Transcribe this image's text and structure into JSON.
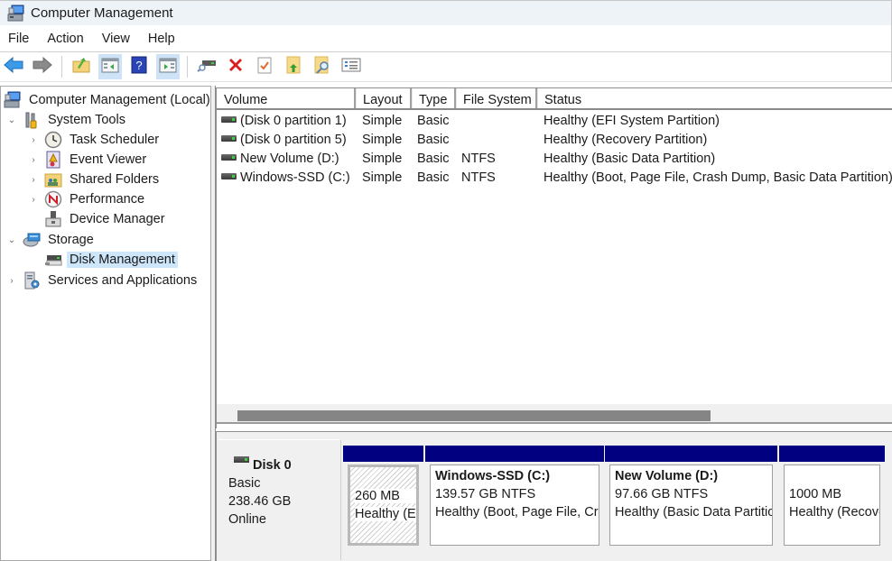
{
  "window": {
    "title": "Computer Management"
  },
  "menu": [
    "File",
    "Action",
    "View",
    "Help"
  ],
  "toolbar": {
    "buttons": [
      {
        "icon": "back-arrow-icon",
        "active": false
      },
      {
        "icon": "forward-arrow-icon",
        "active": false
      },
      {
        "icon": "up-folder-icon",
        "active": false
      },
      {
        "icon": "show-hide-console-tree-icon",
        "active": true
      },
      {
        "icon": "help-icon",
        "active": false
      },
      {
        "icon": "show-hide-action-pane-icon",
        "active": true
      },
      {
        "icon": "connect-virtual-disk-icon",
        "active": false
      },
      {
        "icon": "delete-icon",
        "active": false
      },
      {
        "icon": "properties-check-icon",
        "active": false
      },
      {
        "icon": "export-folder-icon",
        "active": false
      },
      {
        "icon": "search-folder-icon",
        "active": false
      },
      {
        "icon": "list-settings-icon",
        "active": false
      }
    ]
  },
  "tree": {
    "root": "Computer Management (Local)",
    "items": [
      {
        "label": "System Tools",
        "level": 1,
        "chevron": "expanded"
      },
      {
        "label": "Task Scheduler",
        "level": 2,
        "chevron": "collapsed"
      },
      {
        "label": "Event Viewer",
        "level": 2,
        "chevron": "collapsed"
      },
      {
        "label": "Shared Folders",
        "level": 2,
        "chevron": "collapsed"
      },
      {
        "label": "Performance",
        "level": 2,
        "chevron": "collapsed"
      },
      {
        "label": "Device Manager",
        "level": 2,
        "chevron": "none"
      },
      {
        "label": "Storage",
        "level": 1,
        "chevron": "expanded"
      },
      {
        "label": "Disk Management",
        "level": 2,
        "chevron": "none",
        "selected": true
      },
      {
        "label": "Services and Applications",
        "level": 1,
        "chevron": "collapsed"
      }
    ]
  },
  "volumes": {
    "columns": [
      "Volume",
      "Layout",
      "Type",
      "File System",
      "Status"
    ],
    "rows": [
      {
        "volume": "(Disk 0 partition 1)",
        "layout": "Simple",
        "type": "Basic",
        "fs": "",
        "status": "Healthy (EFI System Partition)"
      },
      {
        "volume": "(Disk 0 partition 5)",
        "layout": "Simple",
        "type": "Basic",
        "fs": "",
        "status": "Healthy (Recovery Partition)"
      },
      {
        "volume": "New Volume (D:)",
        "layout": "Simple",
        "type": "Basic",
        "fs": "NTFS",
        "status": "Healthy (Basic Data Partition)"
      },
      {
        "volume": "Windows-SSD (C:)",
        "layout": "Simple",
        "type": "Basic",
        "fs": "NTFS",
        "status": "Healthy (Boot, Page File, Crash Dump, Basic Data Partition)"
      }
    ]
  },
  "disk": {
    "name": "Disk 0",
    "type": "Basic",
    "size": "238.46 GB",
    "state": "Online",
    "partitions": [
      {
        "title": "",
        "size": "260 MB",
        "status": "Healthy (EFI System Partition)",
        "hatched": true
      },
      {
        "title": "Windows-SSD  (C:)",
        "size": "139.57 GB NTFS",
        "status": "Healthy (Boot, Page File, Crash Dump, Basic Data Partition)",
        "hatched": false
      },
      {
        "title": "New Volume  (D:)",
        "size": "97.66 GB NTFS",
        "status": "Healthy (Basic Data Partition)",
        "hatched": false
      },
      {
        "title": "",
        "size": "1000 MB",
        "status": "Healthy (Recovery Partition)",
        "hatched": false
      }
    ]
  },
  "colors": {
    "partition_bar": "#000080",
    "selection": "#cde6fa",
    "toolbar_active": "#cfe3f6"
  }
}
